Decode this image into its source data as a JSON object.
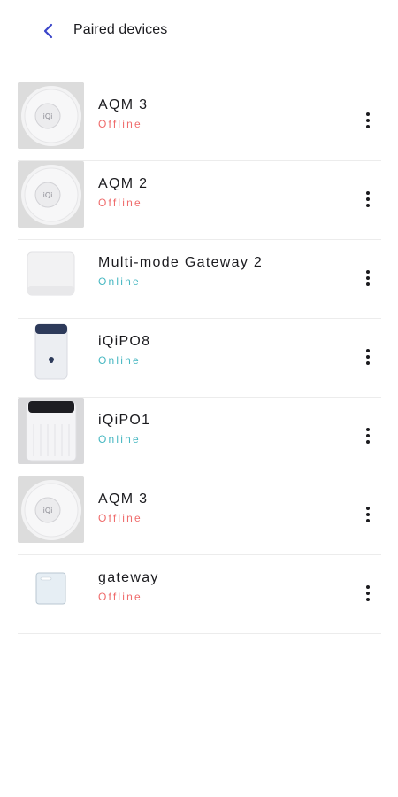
{
  "header": {
    "back_icon": "chevron-left-icon",
    "title": "Paired devices"
  },
  "colors": {
    "accent": "#3a45c9",
    "offline": "#ef6b6b",
    "online": "#48b8c2"
  },
  "devices": [
    {
      "name": "AQM 3",
      "status": "Offline",
      "image": "aqm-sensor-image"
    },
    {
      "name": "AQM 2",
      "status": "Offline",
      "image": "aqm-sensor-image"
    },
    {
      "name": "Multi-mode Gateway 2",
      "status": "Online",
      "image": "gateway-hub-image"
    },
    {
      "name": "iQiPO8",
      "status": "Online",
      "image": "purifier-small-image"
    },
    {
      "name": "iQiPO1",
      "status": "Online",
      "image": "purifier-large-image"
    },
    {
      "name": "AQM 3",
      "status": "Offline",
      "image": "aqm-sensor-image"
    },
    {
      "name": "gateway",
      "status": "Offline",
      "image": "gateway-panel-image"
    }
  ],
  "row_menu_icon": "more-vertical-icon"
}
